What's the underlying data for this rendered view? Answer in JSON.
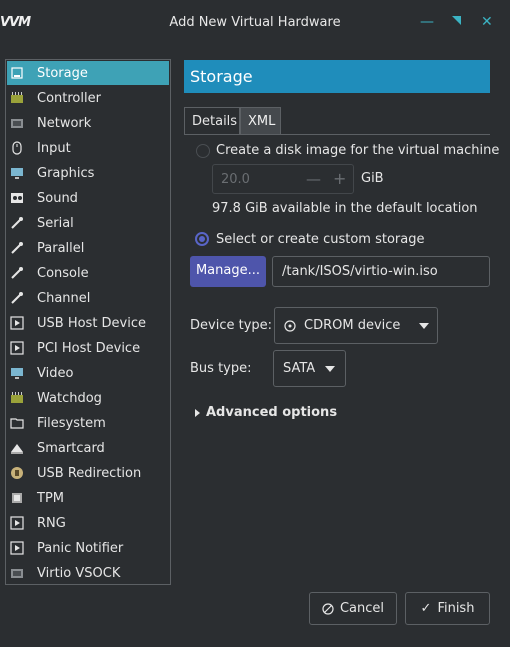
{
  "window": {
    "app_logo": "VVM",
    "title": "Add New Virtual Hardware"
  },
  "sidebar": {
    "items": [
      {
        "label": "Storage",
        "icon": "storage-icon"
      },
      {
        "label": "Controller",
        "icon": "controller-icon"
      },
      {
        "label": "Network",
        "icon": "network-icon"
      },
      {
        "label": "Input",
        "icon": "input-icon"
      },
      {
        "label": "Graphics",
        "icon": "graphics-icon"
      },
      {
        "label": "Sound",
        "icon": "sound-icon"
      },
      {
        "label": "Serial",
        "icon": "serial-icon"
      },
      {
        "label": "Parallel",
        "icon": "parallel-icon"
      },
      {
        "label": "Console",
        "icon": "console-icon"
      },
      {
        "label": "Channel",
        "icon": "channel-icon"
      },
      {
        "label": "USB Host Device",
        "icon": "usb-host-device-icon"
      },
      {
        "label": "PCI Host Device",
        "icon": "pci-host-device-icon"
      },
      {
        "label": "Video",
        "icon": "video-icon"
      },
      {
        "label": "Watchdog",
        "icon": "watchdog-icon"
      },
      {
        "label": "Filesystem",
        "icon": "filesystem-icon"
      },
      {
        "label": "Smartcard",
        "icon": "smartcard-icon"
      },
      {
        "label": "USB Redirection",
        "icon": "usb-redirection-icon"
      },
      {
        "label": "TPM",
        "icon": "tpm-icon"
      },
      {
        "label": "RNG",
        "icon": "rng-icon"
      },
      {
        "label": "Panic Notifier",
        "icon": "panic-notifier-icon"
      },
      {
        "label": "Virtio VSOCK",
        "icon": "virtio-vsock-icon"
      }
    ]
  },
  "main": {
    "header": "Storage",
    "tabs": [
      {
        "label": "Details",
        "active": true
      },
      {
        "label": "XML",
        "active": false
      }
    ],
    "create_disk": {
      "label": "Create a disk image for the virtual machine",
      "size_value": "20.0",
      "size_unit": "GiB",
      "available": "97.8 GiB available in the default location"
    },
    "custom_storage": {
      "label": "Select or create custom storage",
      "manage_label": "Manage...",
      "path": "/tank/ISOS/virtio-win.iso"
    },
    "device_type": {
      "label": "Device type:",
      "value": "CDROM device"
    },
    "bus_type": {
      "label": "Bus type:",
      "value": "SATA"
    },
    "advanced_label": "Advanced options"
  },
  "buttons": {
    "cancel": "Cancel",
    "finish": "Finish"
  },
  "colors": {
    "accent": "#3ea2b6",
    "header": "#1f8dbb",
    "manage_button": "#4e55ab",
    "radio": "#5965c7"
  }
}
